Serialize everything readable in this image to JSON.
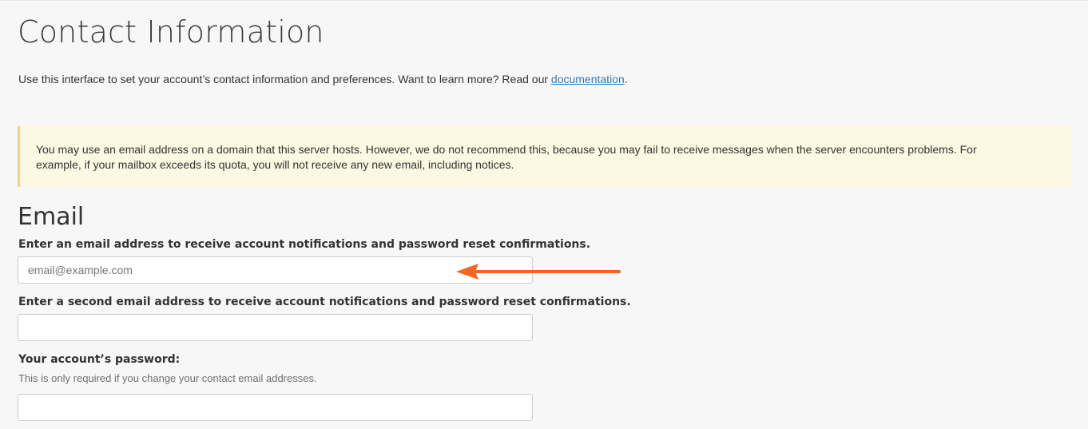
{
  "page": {
    "title": "Contact Information",
    "intro_text": "Use this interface to set your account’s contact information and preferences. Want to learn more? Read our ",
    "intro_link": "documentation",
    "intro_end": "."
  },
  "notice": {
    "text": "You may use an email address on a domain that this server hosts. However, we do not recommend this, because you may fail to receive messages when the server encounters problems. For example, if your mailbox exceeds its quota, you will not receive any new email, including notices."
  },
  "email_section": {
    "heading": "Email",
    "primary": {
      "label": "Enter an email address to receive account notifications and password reset confirmations.",
      "placeholder": "email@example.com",
      "value": ""
    },
    "secondary": {
      "label": "Enter a second email address to receive account notifications and password reset confirmations.",
      "placeholder": "",
      "value": ""
    },
    "password": {
      "label": "Your account’s password:",
      "help": "This is only required if you change your contact email addresses.",
      "value": ""
    }
  },
  "colors": {
    "page_bg": "#f7f7f7",
    "notice_bg": "#fcf8e1",
    "notice_border": "#f0d28a",
    "link": "#337ab7",
    "arrow": "#f26522"
  },
  "icons": {
    "annotation": "arrow-left-icon"
  }
}
